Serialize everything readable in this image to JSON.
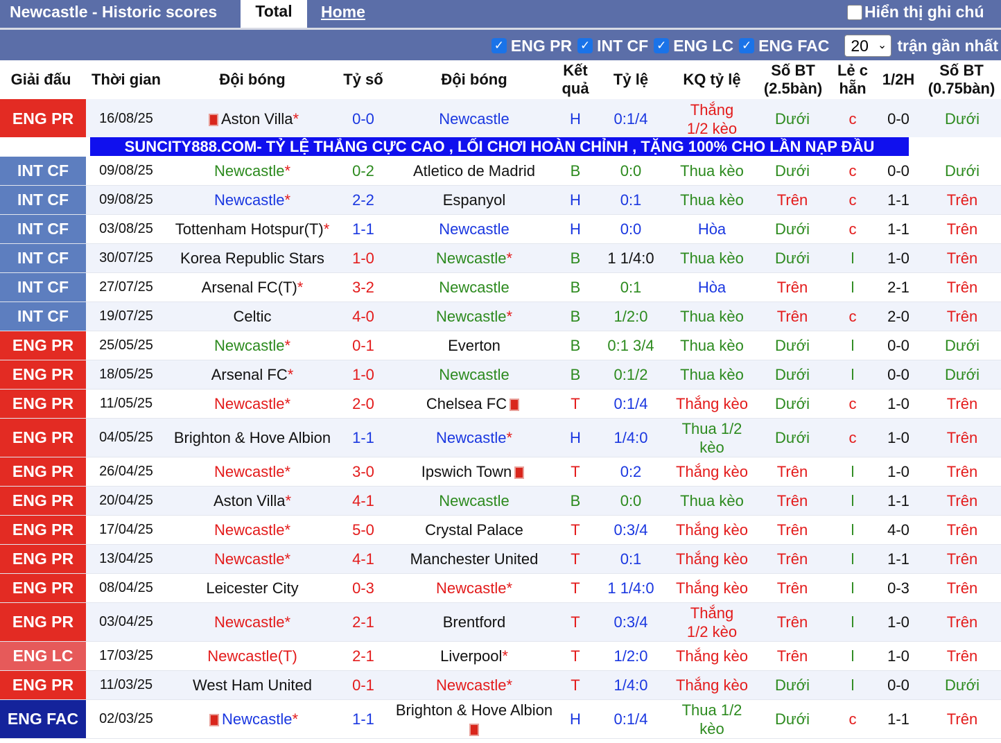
{
  "tabs": {
    "title": "Newcastle - Historic scores",
    "total": "Total",
    "home": "Home",
    "show_notes": "Hiển thị ghi chú"
  },
  "filters": {
    "items": [
      "ENG PR",
      "INT CF",
      "ENG LC",
      "ENG FAC"
    ],
    "count_selected": "20",
    "recent_label": "trận gần nhất"
  },
  "headers": {
    "league": "Giải đấu",
    "time": "Thời gian",
    "team1": "Đội bóng",
    "score": "Tỷ số",
    "team2": "Đội bóng",
    "result": "Kết quả",
    "odds": "Tỷ lệ",
    "odds_result": "KQ tỷ lệ",
    "goals25": "Số BT (2.5bàn)",
    "oddeven": "Lẻ c hẵn",
    "half": "1/2H",
    "goals075": "Số BT (0.75bàn)"
  },
  "banner": "SUNCITY888.COM- TỶ LỆ THẮNG CỰC CAO , LỐI CHƠI HOÀN CHỈNH , TẶNG 100% CHO LẦN NẠP ĐẦU",
  "colors": {
    "eng_pr": "#e32b23",
    "int_cf": "#5d7ebf",
    "eng_lc": "#e65a5a",
    "eng_fac": "#14239b",
    "win": "#e31b1b",
    "draw": "#1a37e0",
    "loss": "#2c8a1e"
  },
  "rows": [
    {
      "league": "ENG PR",
      "lk": "eng_pr",
      "date": "16/08/25",
      "t1": "Aston Villa",
      "t1s": "*",
      "t1c": "#111",
      "t1rc": true,
      "score": "0-0",
      "sc": "draw",
      "t2": "Newcastle",
      "t2s": "",
      "t2c": "draw",
      "t2rc": false,
      "res": "H",
      "rc": "draw",
      "odds": "0:1/4",
      "oddsc": "draw",
      "kq": "Thắng 1/2 kèo",
      "kqc": "win",
      "kqwrap": true,
      "g25": "Dưới",
      "g25c": "loss",
      "oe": "c",
      "oec": "win",
      "half": "0-0",
      "g075": "Dưới",
      "g075c": "loss",
      "h": 58
    },
    {
      "league": "INT CF",
      "lk": "int_cf",
      "date": "09/08/25",
      "t1": "Newcastle",
      "t1s": "*",
      "t1c": "loss",
      "t1rc": false,
      "score": "0-2",
      "sc": "loss",
      "t2": "Atletico de Madrid",
      "t2s": "",
      "t2c": "#111",
      "t2rc": false,
      "res": "B",
      "rc": "loss",
      "odds": "0:0",
      "oddsc": "loss",
      "kq": "Thua kèo",
      "kqc": "loss",
      "kqwrap": false,
      "g25": "Dưới",
      "g25c": "loss",
      "oe": "c",
      "oec": "win",
      "half": "0-0",
      "g075": "Dưới",
      "g075c": "loss",
      "h": 42
    },
    {
      "league": "INT CF",
      "lk": "int_cf",
      "date": "09/08/25",
      "t1": "Newcastle",
      "t1s": "*",
      "t1c": "draw",
      "t1rc": false,
      "score": "2-2",
      "sc": "draw",
      "t2": "Espanyol",
      "t2s": "",
      "t2c": "#111",
      "t2rc": false,
      "res": "H",
      "rc": "draw",
      "odds": "0:1",
      "oddsc": "draw",
      "kq": "Thua kèo",
      "kqc": "loss",
      "kqwrap": false,
      "g25": "Trên",
      "g25c": "win",
      "oe": "c",
      "oec": "win",
      "half": "1-1",
      "g075": "Trên",
      "g075c": "win",
      "h": 42
    },
    {
      "league": "INT CF",
      "lk": "int_cf",
      "date": "03/08/25",
      "t1": "Tottenham Hotspur(T)",
      "t1s": "*",
      "t1c": "#111",
      "t1rc": false,
      "score": "1-1",
      "sc": "draw",
      "t2": "Newcastle",
      "t2s": "",
      "t2c": "draw",
      "t2rc": false,
      "res": "H",
      "rc": "draw",
      "odds": "0:0",
      "oddsc": "draw",
      "kq": "Hòa",
      "kqc": "draw",
      "kqwrap": false,
      "g25": "Dưới",
      "g25c": "loss",
      "oe": "c",
      "oec": "win",
      "half": "1-1",
      "g075": "Trên",
      "g075c": "win",
      "h": 42
    },
    {
      "league": "INT CF",
      "lk": "int_cf",
      "date": "30/07/25",
      "t1": "Korea Republic Stars",
      "t1s": "",
      "t1c": "#111",
      "t1rc": false,
      "score": "1-0",
      "sc": "win",
      "t2": "Newcastle",
      "t2s": "*",
      "t2c": "loss",
      "t2rc": false,
      "res": "B",
      "rc": "loss",
      "odds": "1 1/4:0",
      "oddsc": "#111",
      "kq": "Thua kèo",
      "kqc": "loss",
      "kqwrap": false,
      "g25": "Dưới",
      "g25c": "loss",
      "oe": "l",
      "oec": "loss",
      "half": "1-0",
      "g075": "Trên",
      "g075c": "win",
      "h": 42
    },
    {
      "league": "INT CF",
      "lk": "int_cf",
      "date": "27/07/25",
      "t1": "Arsenal FC(T)",
      "t1s": "*",
      "t1c": "#111",
      "t1rc": false,
      "score": "3-2",
      "sc": "win",
      "t2": "Newcastle",
      "t2s": "",
      "t2c": "loss",
      "t2rc": false,
      "res": "B",
      "rc": "loss",
      "odds": "0:1",
      "oddsc": "loss",
      "kq": "Hòa",
      "kqc": "draw",
      "kqwrap": false,
      "g25": "Trên",
      "g25c": "win",
      "oe": "l",
      "oec": "loss",
      "half": "2-1",
      "g075": "Trên",
      "g075c": "win",
      "h": 42
    },
    {
      "league": "INT CF",
      "lk": "int_cf",
      "date": "19/07/25",
      "t1": "Celtic",
      "t1s": "",
      "t1c": "#111",
      "t1rc": false,
      "score": "4-0",
      "sc": "win",
      "t2": "Newcastle",
      "t2s": "*",
      "t2c": "loss",
      "t2rc": false,
      "res": "B",
      "rc": "loss",
      "odds": "1/2:0",
      "oddsc": "loss",
      "kq": "Thua kèo",
      "kqc": "loss",
      "kqwrap": false,
      "g25": "Trên",
      "g25c": "win",
      "oe": "c",
      "oec": "win",
      "half": "2-0",
      "g075": "Trên",
      "g075c": "win",
      "h": 42
    },
    {
      "league": "ENG PR",
      "lk": "eng_pr",
      "date": "25/05/25",
      "t1": "Newcastle",
      "t1s": "*",
      "t1c": "loss",
      "t1rc": false,
      "score": "0-1",
      "sc": "win",
      "t2": "Everton",
      "t2s": "",
      "t2c": "#111",
      "t2rc": false,
      "res": "B",
      "rc": "loss",
      "odds": "0:1 3/4",
      "oddsc": "loss",
      "kq": "Thua kèo",
      "kqc": "loss",
      "kqwrap": false,
      "g25": "Dưới",
      "g25c": "loss",
      "oe": "l",
      "oec": "loss",
      "half": "0-0",
      "g075": "Dưới",
      "g075c": "loss",
      "h": 42
    },
    {
      "league": "ENG PR",
      "lk": "eng_pr",
      "date": "18/05/25",
      "t1": "Arsenal FC",
      "t1s": "*",
      "t1c": "#111",
      "t1rc": false,
      "score": "1-0",
      "sc": "win",
      "t2": "Newcastle",
      "t2s": "",
      "t2c": "loss",
      "t2rc": false,
      "res": "B",
      "rc": "loss",
      "odds": "0:1/2",
      "oddsc": "loss",
      "kq": "Thua kèo",
      "kqc": "loss",
      "kqwrap": false,
      "g25": "Dưới",
      "g25c": "loss",
      "oe": "l",
      "oec": "loss",
      "half": "0-0",
      "g075": "Dưới",
      "g075c": "loss",
      "h": 42
    },
    {
      "league": "ENG PR",
      "lk": "eng_pr",
      "date": "11/05/25",
      "t1": "Newcastle",
      "t1s": "*",
      "t1c": "win",
      "t1rc": false,
      "score": "2-0",
      "sc": "win",
      "t2": "Chelsea FC",
      "t2s": "",
      "t2c": "#111",
      "t2rc": true,
      "res": "T",
      "rc": "win",
      "odds": "0:1/4",
      "oddsc": "draw",
      "kq": "Thắng kèo",
      "kqc": "win",
      "kqwrap": false,
      "g25": "Dưới",
      "g25c": "loss",
      "oe": "c",
      "oec": "win",
      "half": "1-0",
      "g075": "Trên",
      "g075c": "win",
      "h": 42
    },
    {
      "league": "ENG PR",
      "lk": "eng_pr",
      "date": "04/05/25",
      "t1": "Brighton & Hove Albion",
      "t1s": "",
      "t1c": "#111",
      "t1rc": false,
      "score": "1-1",
      "sc": "draw",
      "t2": "Newcastle",
      "t2s": "*",
      "t2c": "draw",
      "t2rc": false,
      "res": "H",
      "rc": "draw",
      "odds": "1/4:0",
      "oddsc": "draw",
      "kq": "Thua 1/2 kèo",
      "kqc": "loss",
      "kqwrap": true,
      "g25": "Dưới",
      "g25c": "loss",
      "oe": "c",
      "oec": "win",
      "half": "1-0",
      "g075": "Trên",
      "g075c": "win",
      "h": 56
    },
    {
      "league": "ENG PR",
      "lk": "eng_pr",
      "date": "26/04/25",
      "t1": "Newcastle",
      "t1s": "*",
      "t1c": "win",
      "t1rc": false,
      "score": "3-0",
      "sc": "win",
      "t2": "Ipswich Town",
      "t2s": "",
      "t2c": "#111",
      "t2rc": true,
      "res": "T",
      "rc": "win",
      "odds": "0:2",
      "oddsc": "draw",
      "kq": "Thắng kèo",
      "kqc": "win",
      "kqwrap": false,
      "g25": "Trên",
      "g25c": "win",
      "oe": "l",
      "oec": "loss",
      "half": "1-0",
      "g075": "Trên",
      "g075c": "win",
      "h": 42
    },
    {
      "league": "ENG PR",
      "lk": "eng_pr",
      "date": "20/04/25",
      "t1": "Aston Villa",
      "t1s": "*",
      "t1c": "#111",
      "t1rc": false,
      "score": "4-1",
      "sc": "win",
      "t2": "Newcastle",
      "t2s": "",
      "t2c": "loss",
      "t2rc": false,
      "res": "B",
      "rc": "loss",
      "odds": "0:0",
      "oddsc": "loss",
      "kq": "Thua kèo",
      "kqc": "loss",
      "kqwrap": false,
      "g25": "Trên",
      "g25c": "win",
      "oe": "l",
      "oec": "loss",
      "half": "1-1",
      "g075": "Trên",
      "g075c": "win",
      "h": 42
    },
    {
      "league": "ENG PR",
      "lk": "eng_pr",
      "date": "17/04/25",
      "t1": "Newcastle",
      "t1s": "*",
      "t1c": "win",
      "t1rc": false,
      "score": "5-0",
      "sc": "win",
      "t2": "Crystal Palace",
      "t2s": "",
      "t2c": "#111",
      "t2rc": false,
      "res": "T",
      "rc": "win",
      "odds": "0:3/4",
      "oddsc": "draw",
      "kq": "Thắng kèo",
      "kqc": "win",
      "kqwrap": false,
      "g25": "Trên",
      "g25c": "win",
      "oe": "l",
      "oec": "loss",
      "half": "4-0",
      "g075": "Trên",
      "g075c": "win",
      "h": 42
    },
    {
      "league": "ENG PR",
      "lk": "eng_pr",
      "date": "13/04/25",
      "t1": "Newcastle",
      "t1s": "*",
      "t1c": "win",
      "t1rc": false,
      "score": "4-1",
      "sc": "win",
      "t2": "Manchester United",
      "t2s": "",
      "t2c": "#111",
      "t2rc": false,
      "res": "T",
      "rc": "win",
      "odds": "0:1",
      "oddsc": "draw",
      "kq": "Thắng kèo",
      "kqc": "win",
      "kqwrap": false,
      "g25": "Trên",
      "g25c": "win",
      "oe": "l",
      "oec": "loss",
      "half": "1-1",
      "g075": "Trên",
      "g075c": "win",
      "h": 42
    },
    {
      "league": "ENG PR",
      "lk": "eng_pr",
      "date": "08/04/25",
      "t1": "Leicester City",
      "t1s": "",
      "t1c": "#111",
      "t1rc": false,
      "score": "0-3",
      "sc": "win",
      "t2": "Newcastle",
      "t2s": "*",
      "t2c": "win",
      "t2rc": false,
      "res": "T",
      "rc": "win",
      "odds": "1 1/4:0",
      "oddsc": "draw",
      "kq": "Thắng kèo",
      "kqc": "win",
      "kqwrap": false,
      "g25": "Trên",
      "g25c": "win",
      "oe": "l",
      "oec": "loss",
      "half": "0-3",
      "g075": "Trên",
      "g075c": "win",
      "h": 42
    },
    {
      "league": "ENG PR",
      "lk": "eng_pr",
      "date": "03/04/25",
      "t1": "Newcastle",
      "t1s": "*",
      "t1c": "win",
      "t1rc": false,
      "score": "2-1",
      "sc": "win",
      "t2": "Brentford",
      "t2s": "",
      "t2c": "#111",
      "t2rc": false,
      "res": "T",
      "rc": "win",
      "odds": "0:3/4",
      "oddsc": "draw",
      "kq": "Thắng 1/2 kèo",
      "kqc": "win",
      "kqwrap": true,
      "g25": "Trên",
      "g25c": "win",
      "oe": "l",
      "oec": "loss",
      "half": "1-0",
      "g075": "Trên",
      "g075c": "win",
      "h": 56
    },
    {
      "league": "ENG LC",
      "lk": "eng_lc",
      "date": "17/03/25",
      "t1": "Newcastle",
      "t1s": "(T)",
      "t1c": "win",
      "t1rc": false,
      "score": "2-1",
      "sc": "win",
      "t2": "Liverpool",
      "t2s": "*",
      "t2c": "#111",
      "t2rc": false,
      "res": "T",
      "rc": "win",
      "odds": "1/2:0",
      "oddsc": "draw",
      "kq": "Thắng kèo",
      "kqc": "win",
      "kqwrap": false,
      "g25": "Trên",
      "g25c": "win",
      "oe": "l",
      "oec": "loss",
      "half": "1-0",
      "g075": "Trên",
      "g075c": "win",
      "h": 42
    },
    {
      "league": "ENG PR",
      "lk": "eng_pr",
      "date": "11/03/25",
      "t1": "West Ham United",
      "t1s": "",
      "t1c": "#111",
      "t1rc": false,
      "score": "0-1",
      "sc": "win",
      "t2": "Newcastle",
      "t2s": "*",
      "t2c": "win",
      "t2rc": false,
      "res": "T",
      "rc": "win",
      "odds": "1/4:0",
      "oddsc": "draw",
      "kq": "Thắng kèo",
      "kqc": "win",
      "kqwrap": false,
      "g25": "Dưới",
      "g25c": "loss",
      "oe": "l",
      "oec": "loss",
      "half": "0-0",
      "g075": "Dưới",
      "g075c": "loss",
      "h": 42
    },
    {
      "league": "ENG FAC",
      "lk": "eng_fac",
      "date": "02/03/25",
      "t1": "Newcastle",
      "t1s": "*",
      "t1c": "draw",
      "t1rc": true,
      "score": "1-1",
      "sc": "draw",
      "t2": "Brighton & Hove Albion",
      "t2s": "",
      "t2c": "#111",
      "t2rc": true,
      "t2wrap": true,
      "res": "H",
      "rc": "draw",
      "odds": "0:1/4",
      "oddsc": "draw",
      "kq": "Thua 1/2 kèo",
      "kqc": "loss",
      "kqwrap": true,
      "g25": "Dưới",
      "g25c": "loss",
      "oe": "c",
      "oec": "win",
      "half": "1-1",
      "g075": "Trên",
      "g075c": "win",
      "h": 56
    }
  ]
}
